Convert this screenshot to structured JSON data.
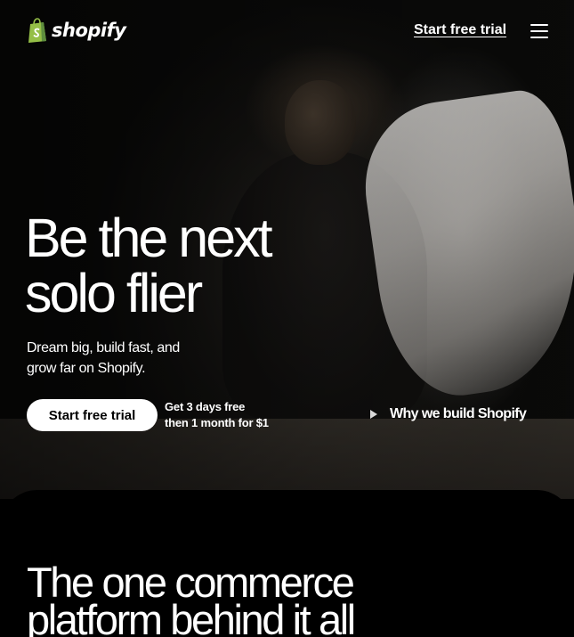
{
  "nav": {
    "logo_text": "shopify",
    "cta_label": "Start free trial",
    "menu_icon": "hamburger-menu-icon"
  },
  "hero": {
    "headline_line1": "Be the next",
    "headline_line2": "solo flier",
    "subhead_line1": "Dream big, build fast, and",
    "subhead_line2": "grow far on Shopify.",
    "cta_label": "Start free trial",
    "trial_note_line1": "Get 3 days free",
    "trial_note_line2": "then 1 month for $1",
    "video_link_label": "Why we build Shopify",
    "video_icon": "play-icon"
  },
  "section2": {
    "title_line1": "The one commerce",
    "title_line2": "platform behind it all"
  },
  "colors": {
    "logo_green": "#95bf47",
    "logo_dark_green": "#5e8e3e",
    "button_bg": "#ffffff",
    "button_text": "#000000",
    "page_bg": "#000000"
  }
}
